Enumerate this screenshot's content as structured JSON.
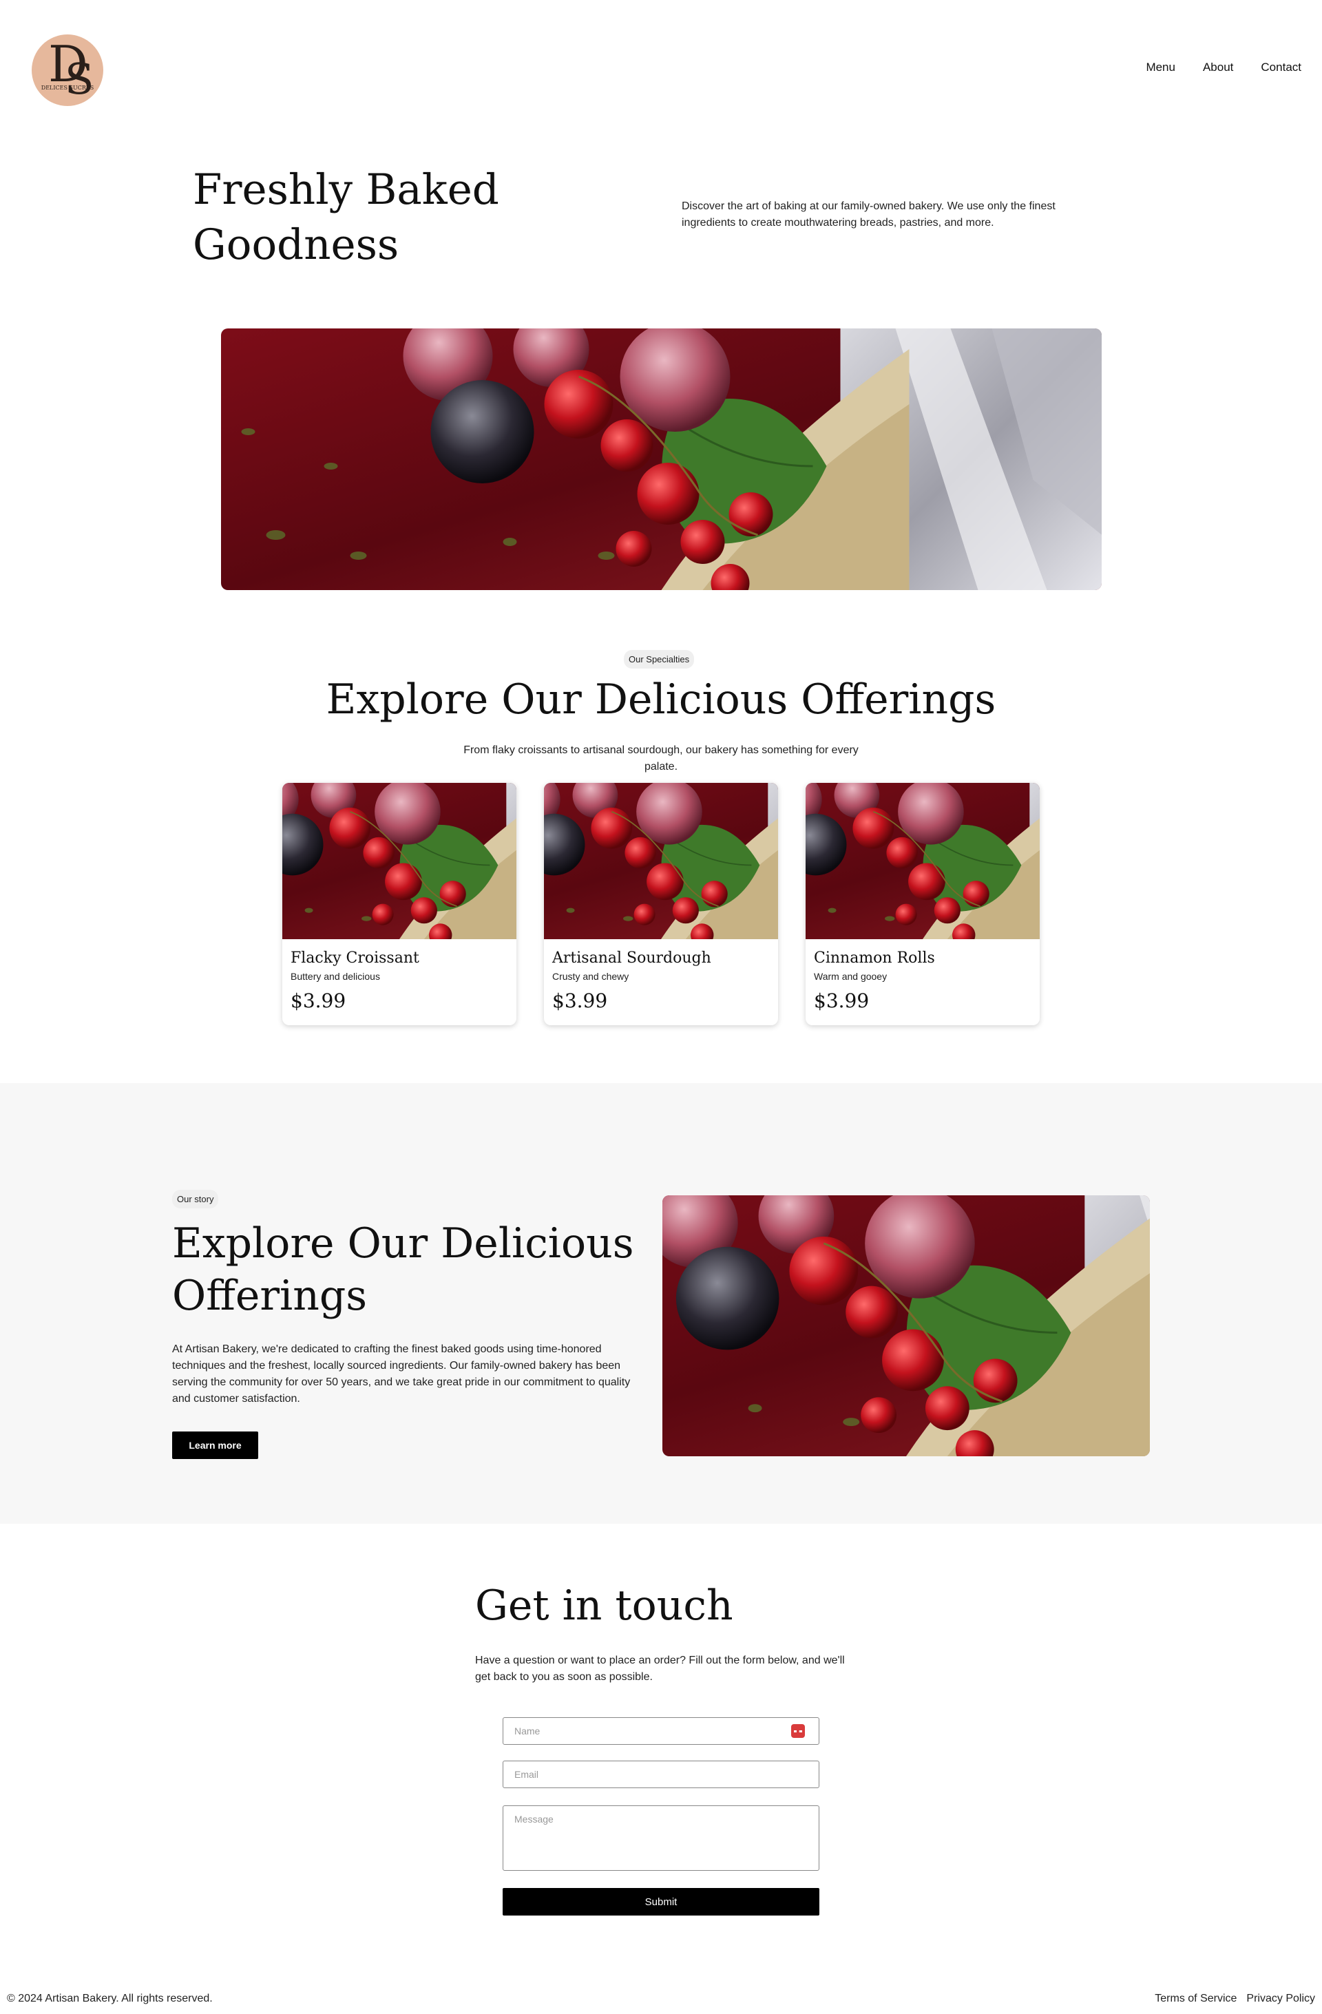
{
  "brand": {
    "logo_text": "DELICES SUCRES",
    "logo_monogram": "DS",
    "logo_color": "#e6b89c"
  },
  "nav": {
    "items": [
      "Menu",
      "About",
      "Contact"
    ]
  },
  "hero": {
    "title": "Freshly Baked Goodness",
    "description": "Discover the art of baking at our family-owned bakery. We use only the finest ingredients to create mouthwatering breads, pastries, and more."
  },
  "specialties": {
    "pill": "Our Specialties",
    "title": "Explore Our Delicious Offerings",
    "description": "From flaky croissants to artisanal sourdough, our bakery has something for every palate.",
    "cards": [
      {
        "name": "Flacky Croissant",
        "subtitle": "Buttery and delicious",
        "price": "$3.99"
      },
      {
        "name": "Artisanal Sourdough",
        "subtitle": "Crusty and chewy",
        "price": "$3.99"
      },
      {
        "name": "Cinnamon Rolls",
        "subtitle": "Warm and gooey",
        "price": "$3.99"
      }
    ]
  },
  "story": {
    "pill": "Our story",
    "title": "Explore Our Delicious Offerings",
    "text": "At Artisan Bakery, we're dedicated to crafting the finest baked goods using time-honored techniques and the freshest, locally sourced ingredients. Our family-owned bakery has been serving the community for over 50 years, and we take great pride in our commitment to quality and customer satisfaction.",
    "button": "Learn more"
  },
  "contact": {
    "title": "Get in touch",
    "description": "Have a question or want to place an order? Fill out the form below, and we'll get back to you as soon as possible.",
    "name_placeholder": "Name",
    "email_placeholder": "Email",
    "message_placeholder": "Message",
    "submit": "Submit"
  },
  "footer": {
    "copyright": "© 2024 Artisan Bakery. All rights reserved.",
    "links": [
      "Terms of Service",
      "Privacy Policy"
    ]
  },
  "colors": {
    "accent": "#000000",
    "section_bg": "#f7f7f7",
    "autofill_icon": "#d93b3b"
  }
}
